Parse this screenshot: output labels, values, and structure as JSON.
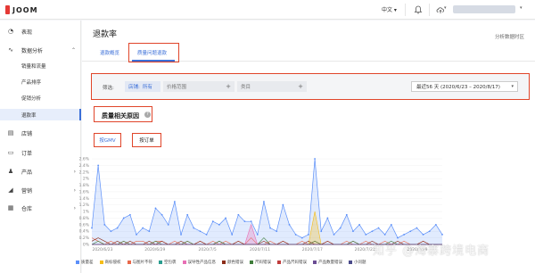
{
  "app": {
    "logo": "JOOM",
    "language": "中文"
  },
  "sidebar": {
    "items": [
      {
        "icon": "dashboard-icon",
        "label": "表现"
      },
      {
        "icon": "analytics-icon",
        "label": "数据分析"
      },
      {
        "icon": "store-icon",
        "label": "店铺"
      },
      {
        "icon": "cart-icon",
        "label": "订单"
      },
      {
        "icon": "shirt-icon",
        "label": "产品"
      },
      {
        "icon": "marketing-icon",
        "label": "营销"
      },
      {
        "icon": "warehouse-icon",
        "label": "仓库"
      }
    ],
    "sub_items": [
      "销量和流量",
      "产品排序",
      "促销分析",
      "退款率"
    ]
  },
  "main": {
    "title": "退款率",
    "region_link": "分析数据时区",
    "tabs": [
      "退款概览",
      "质量问题退款"
    ],
    "filter": {
      "label": "筛选:",
      "shop_label": "店铺:",
      "shop_value": "所有",
      "price_placeholder": "价格范围",
      "category_placeholder": "类目",
      "date_range": "最近56 天 (2020/6/23 – 2020/8/17)"
    },
    "section_title": "质量相关原因",
    "toggle": {
      "gmv": "按GMV",
      "order": "按订单"
    }
  },
  "chart_data": {
    "type": "area",
    "x_ticks": [
      "2020/6/23",
      "2020/6/29",
      "2020/7/5",
      "2020/7/11",
      "2020/7/17",
      "2020/7/23",
      "2020/7/29"
    ],
    "y_ticks": [
      "0%",
      "0.2%",
      "0.4%",
      "0.6%",
      "0.8%",
      "1%",
      "1.2%",
      "1.4%",
      "1.6%",
      "1.8%",
      "2%",
      "2.2%",
      "2.4%",
      "2.6%"
    ],
    "ylim": [
      0,
      2.6
    ],
    "series": [
      {
        "name": "质量差",
        "color": "#5b8ff9",
        "values": [
          0.5,
          2.4,
          0.6,
          0.4,
          0.5,
          0.8,
          0.9,
          0.3,
          0.5,
          0.4,
          1.1,
          0.9,
          0.6,
          1.3,
          0.3,
          0.9,
          0.5,
          0.4,
          0.3,
          0.7,
          0.6,
          0.8,
          0.3,
          0.9,
          0.7,
          0.7,
          0.3,
          1.3,
          0.5,
          0.4,
          1.2,
          0.6,
          0.3,
          0.2,
          0.3,
          2.6,
          0.4,
          0.8,
          0.3,
          0.5,
          0.9,
          0.4,
          0.6,
          0.3,
          0.4,
          0.5,
          0.3,
          0.6,
          0.2,
          0.3,
          0.4,
          0.5,
          0.3,
          0.4,
          0.6,
          0.3
        ]
      },
      {
        "name": "商标侵权",
        "color": "#f6bd16",
        "values": [
          0,
          0,
          0,
          0,
          0,
          0,
          0,
          0,
          0,
          0,
          0,
          0,
          0,
          0,
          0,
          0,
          0,
          0,
          0,
          0,
          0,
          0,
          0,
          0,
          0,
          0,
          0,
          0,
          0,
          0,
          0,
          0,
          0,
          0,
          0,
          1.0,
          0,
          0,
          0,
          0,
          0,
          0,
          0,
          0,
          0,
          0,
          0,
          0,
          0,
          0,
          0,
          0,
          0,
          0,
          0,
          0
        ]
      },
      {
        "name": "与图片不符",
        "color": "#e8684a",
        "values": [
          0.2,
          0.1,
          0,
          0.1,
          0,
          0.1,
          0,
          0.1,
          0.1,
          0,
          0.1,
          0.1,
          0,
          0.1,
          0,
          0.1,
          0,
          0.1,
          0,
          0.1,
          0,
          0.1,
          0,
          0.1,
          0,
          0.2,
          0,
          0,
          0.1,
          0,
          0.1,
          0,
          0,
          0.1,
          0,
          0.1,
          0,
          0.1,
          0,
          0,
          0.1,
          0,
          0,
          0.1,
          0,
          0,
          0.1,
          0,
          0,
          0.1,
          0,
          0,
          0.1,
          0,
          0,
          0
        ]
      },
      {
        "name": "空包裹",
        "color": "#2a9d8f",
        "values": [
          0,
          0,
          0,
          0,
          0,
          0,
          0,
          0,
          0,
          0,
          0,
          0,
          0,
          0,
          0,
          0,
          0,
          0,
          0,
          0,
          0,
          0,
          0,
          0,
          0,
          0,
          0,
          0,
          0,
          0,
          0,
          0,
          0,
          0,
          0,
          0,
          0,
          0,
          0,
          0,
          0,
          0,
          0,
          0,
          0,
          0,
          0,
          0,
          0,
          0,
          0,
          0,
          0,
          0,
          0,
          0
        ]
      },
      {
        "name": "误导性产品信息",
        "color": "#e86fb5",
        "values": [
          0,
          0,
          0,
          0,
          0,
          0,
          0,
          0,
          0,
          0,
          0,
          0,
          0,
          0,
          0,
          0,
          0,
          0,
          0,
          0,
          0,
          0,
          0,
          0,
          0,
          0.6,
          0,
          0,
          0,
          0,
          0,
          0,
          0,
          0,
          0,
          0,
          0,
          0,
          0,
          0,
          0,
          0,
          0,
          0,
          0,
          0,
          0,
          0,
          0,
          0,
          0,
          0,
          0,
          0,
          0,
          0
        ]
      },
      {
        "name": "颜色错误",
        "color": "#8c2d19",
        "values": [
          0.1,
          0.2,
          0.1,
          0,
          0.1,
          0,
          0.1,
          0,
          0,
          0.1,
          0,
          0.1,
          0,
          0,
          0.1,
          0,
          0,
          0.1,
          0,
          0,
          0.1,
          0,
          0,
          0.1,
          0,
          0,
          0,
          0.1,
          0,
          0,
          0.1,
          0,
          0,
          0,
          0.1,
          0,
          0,
          0.1,
          0,
          0,
          0,
          0.1,
          0,
          0,
          0.1,
          0,
          0,
          0,
          0.1,
          0,
          0,
          0,
          0.1,
          0,
          0,
          0
        ]
      },
      {
        "name": "尺码错误",
        "color": "#3f7d3a",
        "values": [
          0,
          0.1,
          0,
          0,
          0,
          0.1,
          0,
          0,
          0,
          0,
          0.1,
          0,
          0,
          0,
          0,
          0.1,
          0,
          0,
          0,
          0,
          0.1,
          0,
          0,
          0,
          0,
          0,
          0,
          0.2,
          0,
          0,
          0,
          0,
          0,
          0,
          0,
          0.1,
          0,
          0,
          0,
          0,
          0,
          0.1,
          0,
          0,
          0,
          0,
          0,
          0.1,
          0,
          0,
          0,
          0,
          0,
          0,
          0,
          0
        ]
      },
      {
        "name": "产品尺码错误",
        "color": "#c03c3c",
        "values": [
          0,
          0,
          0,
          0,
          0,
          0,
          0,
          0,
          0,
          0,
          0,
          0,
          0,
          0,
          0,
          0,
          0,
          0,
          0,
          0,
          0,
          0,
          0,
          0,
          0,
          0,
          0,
          0,
          0,
          0,
          0,
          0,
          0,
          0,
          0,
          0,
          0,
          0,
          0,
          0,
          0,
          0,
          0,
          0,
          0,
          0,
          0,
          0,
          0,
          0,
          0,
          0,
          0,
          0,
          0,
          0
        ]
      },
      {
        "name": "产品数量错误",
        "color": "#6a4c93",
        "values": [
          0,
          0,
          0,
          0,
          0,
          0,
          0,
          0,
          0,
          0,
          0,
          0,
          0,
          0,
          0,
          0,
          0,
          0,
          0,
          0,
          0,
          0,
          0,
          0,
          0,
          0,
          0,
          0,
          0,
          0,
          0,
          0,
          0,
          0,
          0,
          0,
          0,
          0,
          0,
          0,
          0,
          0,
          0,
          0,
          0,
          0,
          0,
          0,
          0,
          0,
          0,
          0,
          0,
          0,
          0,
          0
        ]
      },
      {
        "name": "小问题",
        "color": "#4a4a8a",
        "values": [
          0,
          0,
          0,
          0,
          0,
          0,
          0,
          0,
          0,
          0,
          0,
          0,
          0,
          0,
          0,
          0,
          0,
          0,
          0,
          0,
          0,
          0,
          0,
          0,
          0,
          0,
          0,
          0,
          0,
          0,
          0,
          0,
          0,
          0,
          0,
          0,
          0,
          0,
          0,
          0,
          0,
          0,
          0,
          0,
          0,
          0,
          0,
          0,
          0,
          0,
          0,
          0,
          0,
          0,
          0,
          0
        ]
      }
    ]
  },
  "watermark": "知乎 @海寨跨境电商"
}
